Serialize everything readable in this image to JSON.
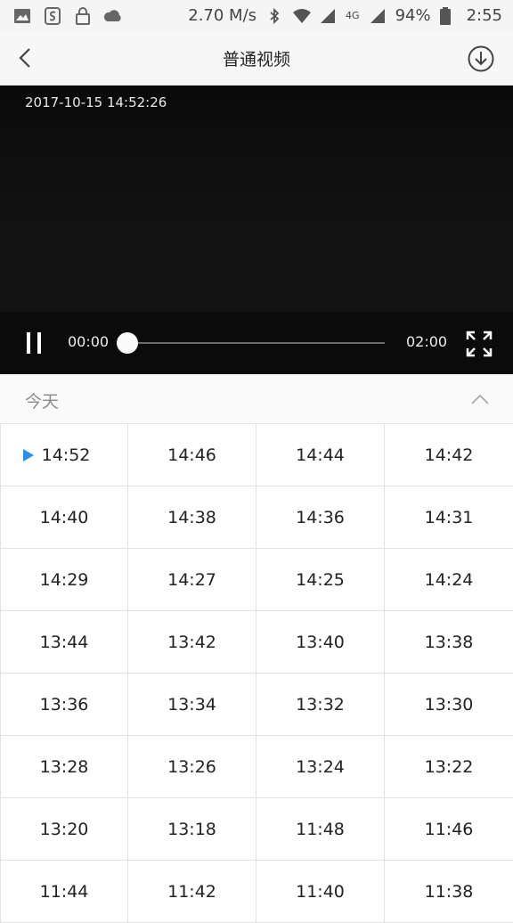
{
  "status_bar": {
    "speed": "2.70 M/s",
    "network": "4G",
    "battery": "94%",
    "time": "2:55"
  },
  "header": {
    "title": "普通视频"
  },
  "player": {
    "timestamp": "2017-10-15 14:52:26",
    "current_time": "00:00",
    "total_time": "02:00",
    "progress": 0
  },
  "day_section": {
    "label": "今天"
  },
  "clips": [
    "14:52",
    "14:46",
    "14:44",
    "14:42",
    "14:40",
    "14:38",
    "14:36",
    "14:31",
    "14:29",
    "14:27",
    "14:25",
    "14:24",
    "13:44",
    "13:42",
    "13:40",
    "13:38",
    "13:36",
    "13:34",
    "13:32",
    "13:30",
    "13:28",
    "13:26",
    "13:24",
    "13:22",
    "13:20",
    "13:18",
    "11:48",
    "11:46",
    "11:44",
    "11:42",
    "11:40",
    "11:38"
  ],
  "active_clip_index": 0,
  "colors": {
    "accent": "#2a8ef0"
  }
}
